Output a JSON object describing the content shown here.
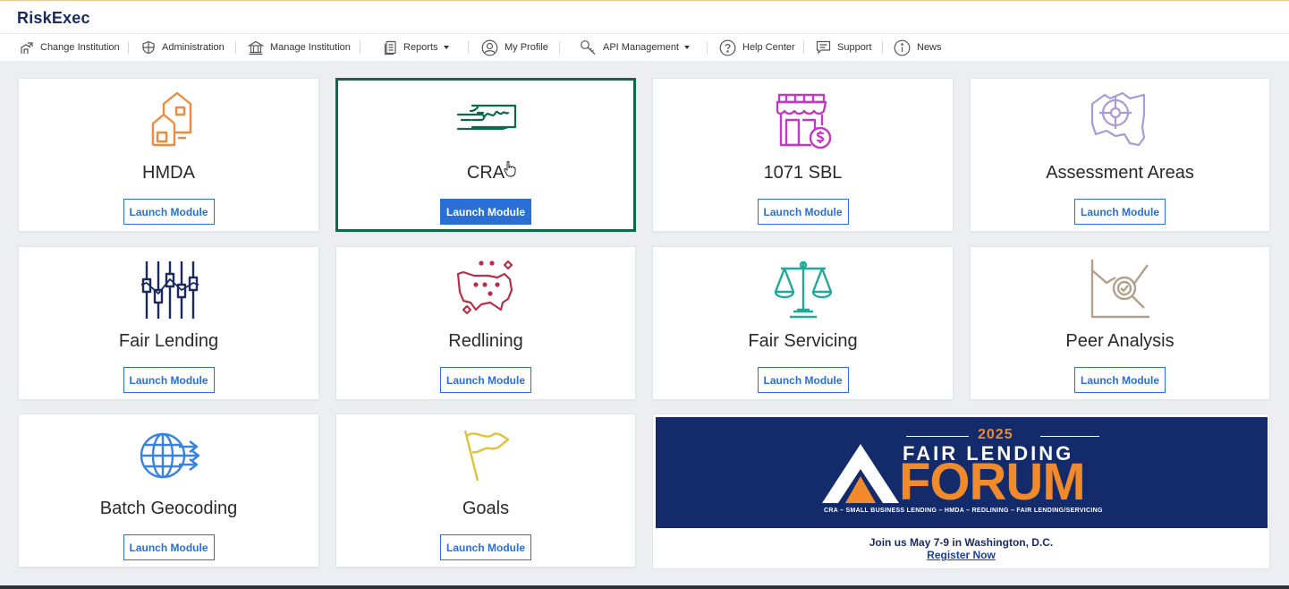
{
  "app": {
    "logo": "RiskExec"
  },
  "nav": {
    "items": [
      {
        "label": "Change Institution",
        "icon": "change-institution-icon"
      },
      {
        "label": "Administration",
        "icon": "shield-icon"
      },
      {
        "label": "Manage Institution",
        "icon": "bank-icon"
      },
      {
        "label": "Reports",
        "icon": "report-icon",
        "dropdown": true
      },
      {
        "label": "My Profile",
        "icon": "user-icon"
      },
      {
        "label": "API Management",
        "icon": "key-icon",
        "dropdown": true
      },
      {
        "label": "Help Center",
        "icon": "help-icon"
      },
      {
        "label": "Support",
        "icon": "chat-icon"
      },
      {
        "label": "News",
        "icon": "info-icon"
      }
    ]
  },
  "modules": [
    {
      "title": "HMDA",
      "button": "Launch Module",
      "icon": "houses-icon",
      "color": "#f08a3e"
    },
    {
      "title": "CRA",
      "button": "Launch Module",
      "icon": "check-hand-icon",
      "color": "#0b6b47",
      "active": true
    },
    {
      "title": "1071 SBL",
      "button": "Launch Module",
      "icon": "storefront-dollar-icon",
      "color": "#c03bc4"
    },
    {
      "title": "Assessment Areas",
      "button": "Launch Module",
      "icon": "map-target-icon",
      "color": "#a99bd8"
    },
    {
      "title": "Fair Lending",
      "button": "Launch Module",
      "icon": "sliders-icon",
      "color": "#1a2a5e"
    },
    {
      "title": "Redlining",
      "button": "Launch Module",
      "icon": "us-map-icon",
      "color": "#b5304a"
    },
    {
      "title": "Fair Servicing",
      "button": "Launch Module",
      "icon": "scales-icon",
      "color": "#1ea99a"
    },
    {
      "title": "Peer Analysis",
      "button": "Launch Module",
      "icon": "chart-magnifier-icon",
      "color": "#b3a08c"
    },
    {
      "title": "Batch Geocoding",
      "button": "Launch Module",
      "icon": "globe-arrows-icon",
      "color": "#3a82e0"
    },
    {
      "title": "Goals",
      "button": "Launch Module",
      "icon": "flag-icon",
      "color": "#e0c23a"
    }
  ],
  "banner": {
    "year": "2025",
    "line1": "FAIR LENDING",
    "line2": "FORUM",
    "tagline": "CRA – SMALL BUSINESS LENDING – HMDA – REDLINING – FAIR LENDING/SERVICING",
    "text": "Join us May 7-9 in Washington, D.C.",
    "link": "Register Now"
  }
}
